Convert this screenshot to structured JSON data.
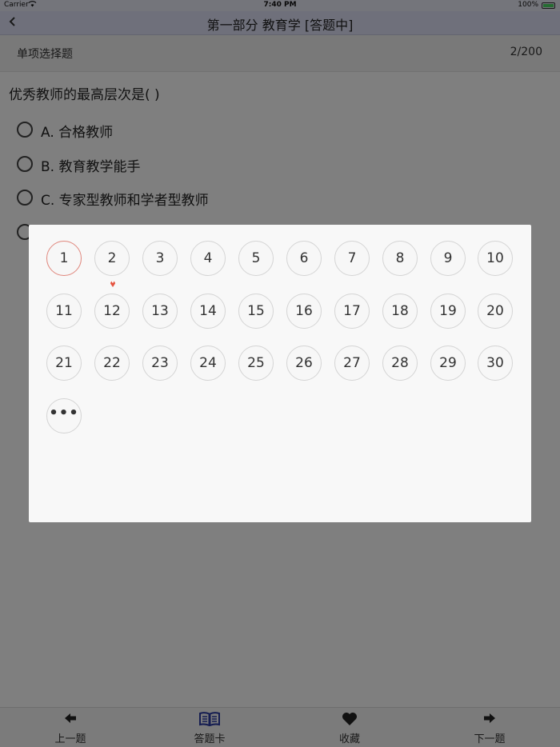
{
  "status_bar": {
    "carrier": "Carrier",
    "time": "7:40 PM",
    "battery": "100%"
  },
  "nav": {
    "title": "第一部分 教育学 [答题中]"
  },
  "sub_header": {
    "question_type": "单项选择题",
    "progress": "2/200"
  },
  "question": {
    "text": "优秀教师的最高层次是(    )",
    "options": [
      {
        "label": "A. 合格教师"
      },
      {
        "label": "B. 教育教学能手"
      },
      {
        "label": "C. 专家型教师和学者型教师"
      }
    ]
  },
  "toolbar": {
    "prev": "上一题",
    "card": "答题卡",
    "favorite": "收藏",
    "next": "下一题"
  },
  "answer_card": {
    "current": "1",
    "marked": "2",
    "numbers": [
      "1",
      "2",
      "3",
      "4",
      "5",
      "6",
      "7",
      "8",
      "9",
      "10",
      "11",
      "12",
      "13",
      "14",
      "15",
      "16",
      "17",
      "18",
      "19",
      "20",
      "21",
      "22",
      "23",
      "24",
      "25",
      "26",
      "27",
      "28",
      "29",
      "30"
    ],
    "more_label": "•••"
  },
  "colors": {
    "accent": "#2b3ba3",
    "current_border": "#e0867c",
    "pin": "#e5533f"
  }
}
